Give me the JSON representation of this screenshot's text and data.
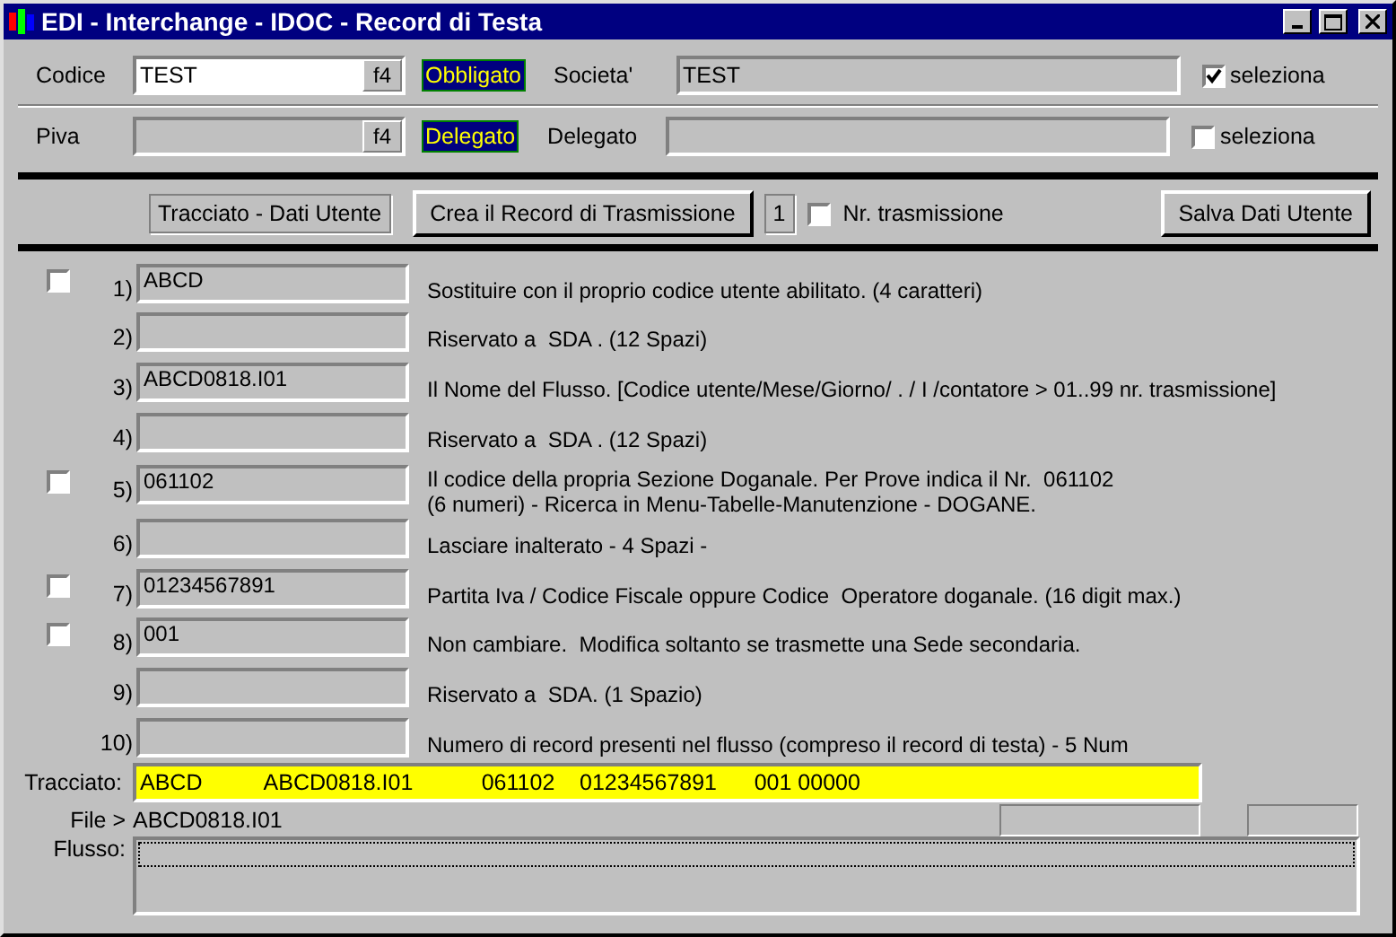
{
  "window": {
    "title": "EDI - Interchange - IDOC - Record di Testa"
  },
  "header_rows": [
    {
      "label": "Codice",
      "value": "TEST",
      "editable": true,
      "key_button": "f4",
      "badge": "Obbligato",
      "field_label": "Societa'",
      "field_value": "TEST",
      "select_label": "seleziona",
      "checked": true
    },
    {
      "label": "Piva",
      "editable": false,
      "key_button": "f4",
      "badge": "Delegato",
      "field_label": "Delegato",
      "select_label": "seleziona",
      "checked": false
    }
  ],
  "toolbar": {
    "layout_label": "Tracciato - Dati Utente",
    "create_button": "Crea il Record di Trasmissione",
    "count": "1",
    "count_label": "Nr. trasmissione",
    "count_checked": false,
    "save_button": "Salva Dati Utente"
  },
  "records": [
    {
      "number": "1)",
      "value": "ABCD",
      "description": "Sostituire con il proprio codice utente abilitato. (4 caratteri)",
      "checked": false
    },
    {
      "number": "2)",
      "description": "Riservato a  SDA . (12 Spazi)"
    },
    {
      "number": "3)",
      "value": "ABCD0818.I01",
      "description": "Il Nome del Flusso. [Codice utente/Mese/Giorno/ . / I /contatore > 01..99 nr. trasmissione]"
    },
    {
      "number": "4)",
      "description": "Riservato a  SDA . (12 Spazi)"
    },
    {
      "number": "5)",
      "value": "061102",
      "description": "Il codice della propria Sezione Doganale. Per Prove indica il Nr.  061102\n(6 numeri) - Ricerca in Menu-Tabelle-Manutenzione - DOGANE.",
      "checked": false
    },
    {
      "number": "6)",
      "description": "Lasciare inalterato - 4 Spazi -"
    },
    {
      "number": "7)",
      "value": "01234567891",
      "description": "Partita Iva / Codice Fiscale oppure Codice  Operatore doganale. (16 digit max.)",
      "checked": false
    },
    {
      "number": "8)",
      "value": "001",
      "description": "Non cambiare.  Modifica soltanto se trasmette una Sede secondaria.",
      "checked": false
    },
    {
      "number": "9)",
      "description": "Riservato a  SDA. (1 Spazio)"
    },
    {
      "number": "10)",
      "description": "Numero di record presenti nel flusso (compreso il record di testa) - 5 Num"
    }
  ],
  "tracciato": {
    "label": "Tracciato:",
    "value": "ABCD          ABCD0818.I01           061102    01234567891      001 00000"
  },
  "file": {
    "label": "File >",
    "value": "ABCD0818.I01"
  },
  "flusso": {
    "label": "Flusso:"
  }
}
